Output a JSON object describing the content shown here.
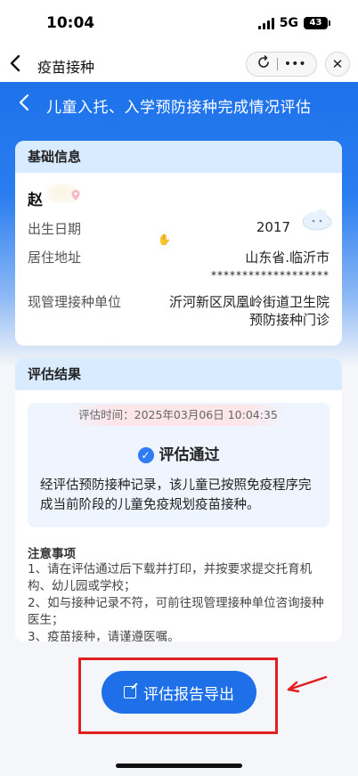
{
  "status_bar": {
    "time": "10:04",
    "network": "5G",
    "battery": "43"
  },
  "app_nav": {
    "back_icon": "chevron-left-icon",
    "title": "疫苗接种",
    "capsule_icons": [
      "refresh-icon",
      "more-icon"
    ],
    "close_icon": "close-icon"
  },
  "page": {
    "title": "儿童入托、入学预防接种完成情况评估"
  },
  "basic_info": {
    "heading": "基础信息",
    "name": "赵",
    "rows": [
      {
        "label": "出生日期",
        "value": "2017"
      },
      {
        "label": "居住地址",
        "value": "山东省.临沂市",
        "value2": "*******************"
      },
      {
        "label": "现管理接种单位",
        "value": "沂河新区凤凰岭街道卫生院",
        "value2": "预防接种门诊"
      }
    ]
  },
  "result": {
    "heading": "评估结果",
    "time": "评估时间：2025年03月06日 10:04:35",
    "status": "评估通过",
    "description": "经评估预防接种记录，该儿童已按照免疫程序完成当前阶段的儿童免疫规划疫苗接种。",
    "notes_title": "注意事项",
    "notes": [
      "1、请在评估通过后下载并打印，并按要求提交托育机构、幼儿园或学校；",
      "2、如与接种记录不符，可前往现管理接种单位咨询接种医生；",
      "3、疫苗接种，请谨遵医嘱。"
    ]
  },
  "export_button": {
    "label": "评估报告导出",
    "icon": "edit-icon"
  },
  "colors": {
    "primary": "#1e6fe8",
    "card_header": "#d9ecff",
    "highlight": "#e02020"
  }
}
